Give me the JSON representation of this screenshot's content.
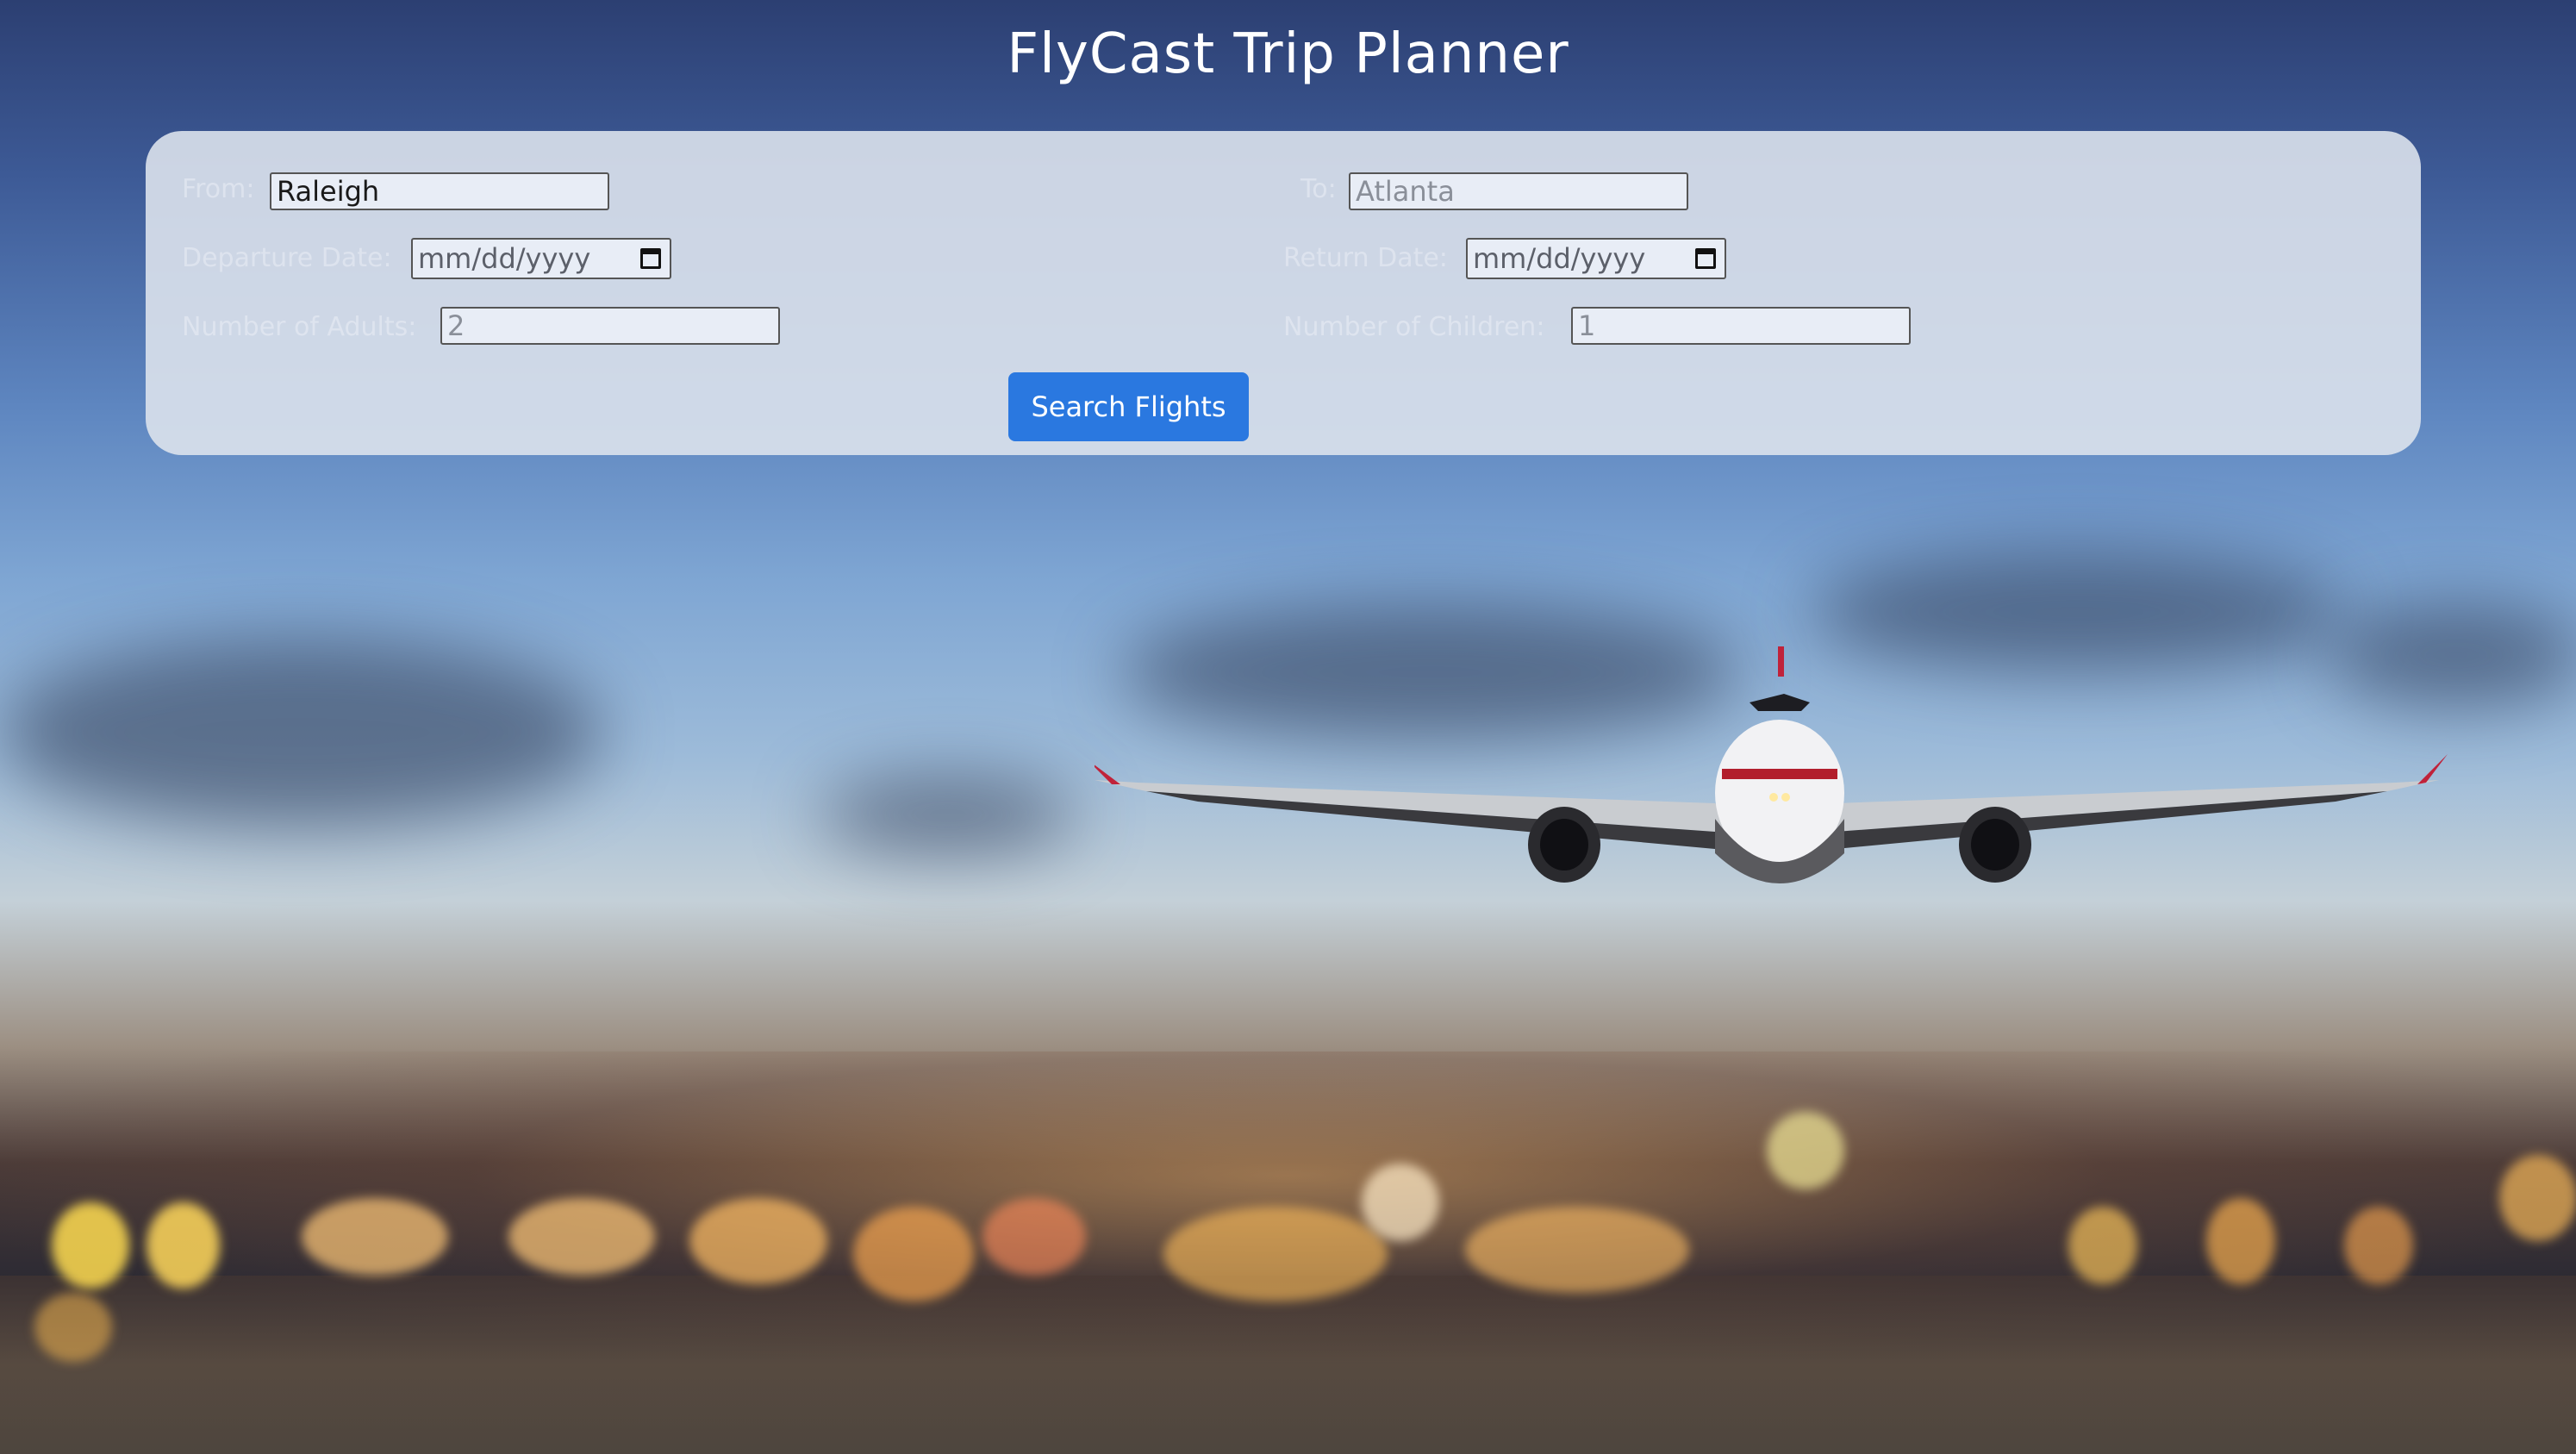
{
  "app": {
    "title": "FlyCast Trip Planner"
  },
  "form": {
    "from": {
      "label": "From:",
      "value": "Raleigh"
    },
    "to": {
      "label": "To:",
      "placeholder": "Atlanta"
    },
    "departure_date": {
      "label": "Departure Date:",
      "placeholder": "mm/dd/yyyy"
    },
    "return_date": {
      "label": "Return Date:",
      "placeholder": "mm/dd/yyyy"
    },
    "adults": {
      "label": "Number of Adults:",
      "placeholder": "2"
    },
    "children": {
      "label": "Number of Children:",
      "placeholder": "1"
    },
    "search_button": "Search Flights"
  },
  "colors": {
    "accent": "#2a78e0",
    "card": "#dce2ec"
  },
  "icons": {
    "calendar": "calendar-icon"
  }
}
